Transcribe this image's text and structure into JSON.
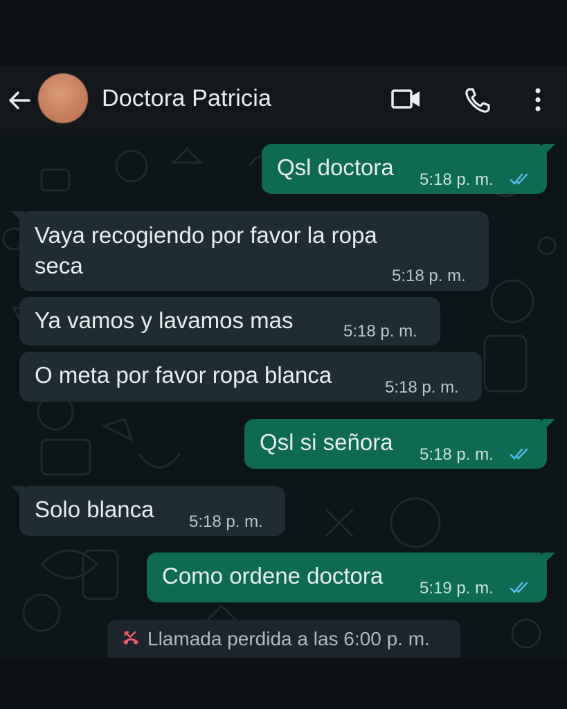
{
  "header": {
    "contact_name": "Doctora Patricia",
    "back_icon": "arrow-left-icon",
    "video_icon": "video-call-icon",
    "call_icon": "phone-icon",
    "menu_icon": "more-vert-icon"
  },
  "messages": [
    {
      "direction": "out",
      "text": "Qsl doctora",
      "time": "5:18 p. m.",
      "status": "read"
    },
    {
      "direction": "in",
      "text_lines": [
        "Vaya recogiendo por favor la ropa",
        "seca"
      ],
      "time": "5:18 p. m."
    },
    {
      "direction": "in",
      "text": "Ya vamos y lavamos mas",
      "time": "5:18 p. m."
    },
    {
      "direction": "in",
      "text": "O meta por favor ropa blanca",
      "time": "5:18 p. m."
    },
    {
      "direction": "out",
      "text": "Qsl si señora",
      "time": "5:18 p. m.",
      "status": "read"
    },
    {
      "direction": "in",
      "text": "Solo blanca",
      "time": "5:18 p. m."
    },
    {
      "direction": "out",
      "text": "Como ordene doctora",
      "time": "5:19 p. m.",
      "status": "read"
    }
  ],
  "system_message": {
    "icon": "missed-call-icon",
    "text": "Llamada perdida a las 6:00 p. m."
  },
  "colors": {
    "outgoing_bubble": "#0e6b52",
    "incoming_bubble": "#202c33",
    "read_ticks": "#53bdeb",
    "missed_call": "#f15c6d"
  }
}
